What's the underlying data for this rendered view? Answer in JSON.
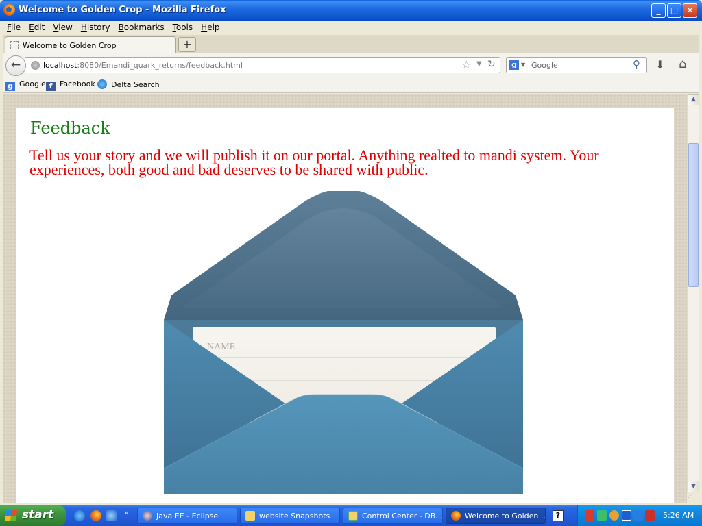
{
  "window": {
    "title": "Welcome to Golden Crop - Mozilla Firefox",
    "minimize_glyph": "_",
    "maximize_glyph": "□",
    "close_glyph": "✕"
  },
  "menu": [
    "File",
    "Edit",
    "View",
    "History",
    "Bookmarks",
    "Tools",
    "Help"
  ],
  "tabs": {
    "active_title": "Welcome to Golden Crop",
    "new_tab_glyph": "+"
  },
  "navbar": {
    "url_host": "localhost",
    "url_rest": ":8080/Emandi_quark_returns/feedback.html",
    "search_engine_letter": "g",
    "search_placeholder": "Google"
  },
  "bookmarks": [
    {
      "label": "Google",
      "icon": "google-icon",
      "glyph": "g"
    },
    {
      "label": "Facebook",
      "icon": "facebook-icon",
      "glyph": "f"
    },
    {
      "label": "Delta Search",
      "icon": "delta-search-icon",
      "glyph": ""
    }
  ],
  "page": {
    "heading": "Feedback",
    "intro": "Tell us your story and we will publish it on our portal. Anything realted to mandi system. Your experiences, both good and bad deserves to be shared with public.",
    "form": {
      "name_label": "NAME"
    }
  },
  "taskbar": {
    "start_label": "start",
    "more_glyph": "»",
    "tasks": [
      {
        "label": "Java EE - Eclipse",
        "active": false
      },
      {
        "label": "website Snapshots",
        "active": false
      },
      {
        "label": "Control Center - DB...",
        "active": false
      },
      {
        "label": "Welcome to Golden ...",
        "active": true
      }
    ],
    "help_glyph": "?",
    "clock": "5:26 AM"
  },
  "colors": {
    "heading": "#187d18",
    "intro": "#e10000",
    "envelope_dark": "#4d6f8a",
    "envelope_light": "#4f8db2"
  }
}
